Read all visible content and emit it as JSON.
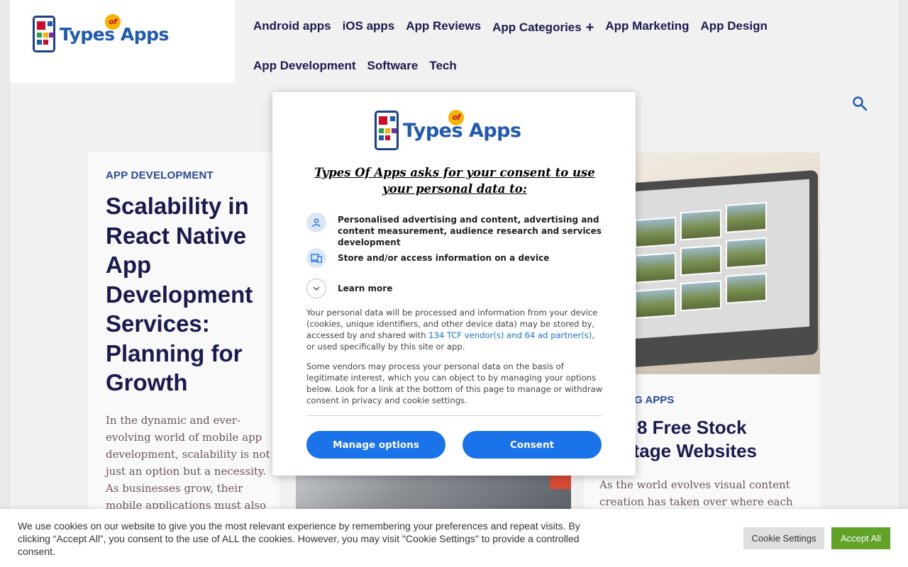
{
  "site": {
    "logo_alt": "Types Of Apps",
    "logo_word_1": "Types",
    "logo_word_2": "Apps",
    "logo_of": "of"
  },
  "nav": {
    "row1": [
      "Android apps",
      "iOS apps",
      "App Reviews",
      "App Categories",
      "App Marketing",
      "App Design"
    ],
    "row2": [
      "App Development",
      "Software",
      "Tech"
    ],
    "expand_symbol": "+"
  },
  "articles": {
    "left": {
      "category": "APP DEVELOPMENT",
      "title": "Scalability in React Native App Development Services: Planning for Growth",
      "excerpt": "In the dynamic and ever-evolving world of mobile app development, scalability is not just an option but a necessity. As businesses grow, their mobile applications must also be able"
    },
    "right": {
      "category": "EDITING APPS",
      "title": "Top 8 Free Stock Footage Websites",
      "title_visible": "Top 8 Free Stock\ntage Websites",
      "excerpt": "As the world evolves visual content creation has taken over where each"
    }
  },
  "consent_modal": {
    "title": "Types Of Apps asks for your consent to use your personal data to:",
    "purposes": [
      {
        "icon": "person-icon",
        "label": "Personalised advertising and content, advertising and content measurement, audience research and services development"
      },
      {
        "icon": "devices-icon",
        "label": "Store and/or access information on a device"
      },
      {
        "icon": "chevron-down-icon",
        "label": "Learn more"
      }
    ],
    "body_1_pre": "Your personal data will be processed and information from your device (cookies, unique identifiers, and other device data) may be stored by, accessed by and shared with ",
    "body_1_link": "134 TCF vendor(s) and 64 ad partner(s)",
    "body_1_post": ", or used specifically by this site or app.",
    "body_2": "Some vendors may process your personal data on the basis of legitimate interest, which you can object to by managing your options below. Look for a link at the bottom of this page to manage or withdraw consent in privacy and cookie settings.",
    "manage_label": "Manage options",
    "consent_label": "Consent"
  },
  "cookie_bar": {
    "text": "We use cookies on our website to give you the most relevant experience by remembering your preferences and repeat visits. By clicking “Accept All”, you consent to the use of ALL the cookies. However, you may visit \"Cookie Settings\" to provide a controlled consent.",
    "settings_label": "Cookie Settings",
    "accept_label": "Accept All"
  },
  "colors": {
    "brand_blue": "#1f5ab0",
    "nav_text": "#1a1a4e",
    "button_blue": "#1a73e8",
    "accept_green": "#61a229",
    "category_blue": "#2d4a9a"
  }
}
